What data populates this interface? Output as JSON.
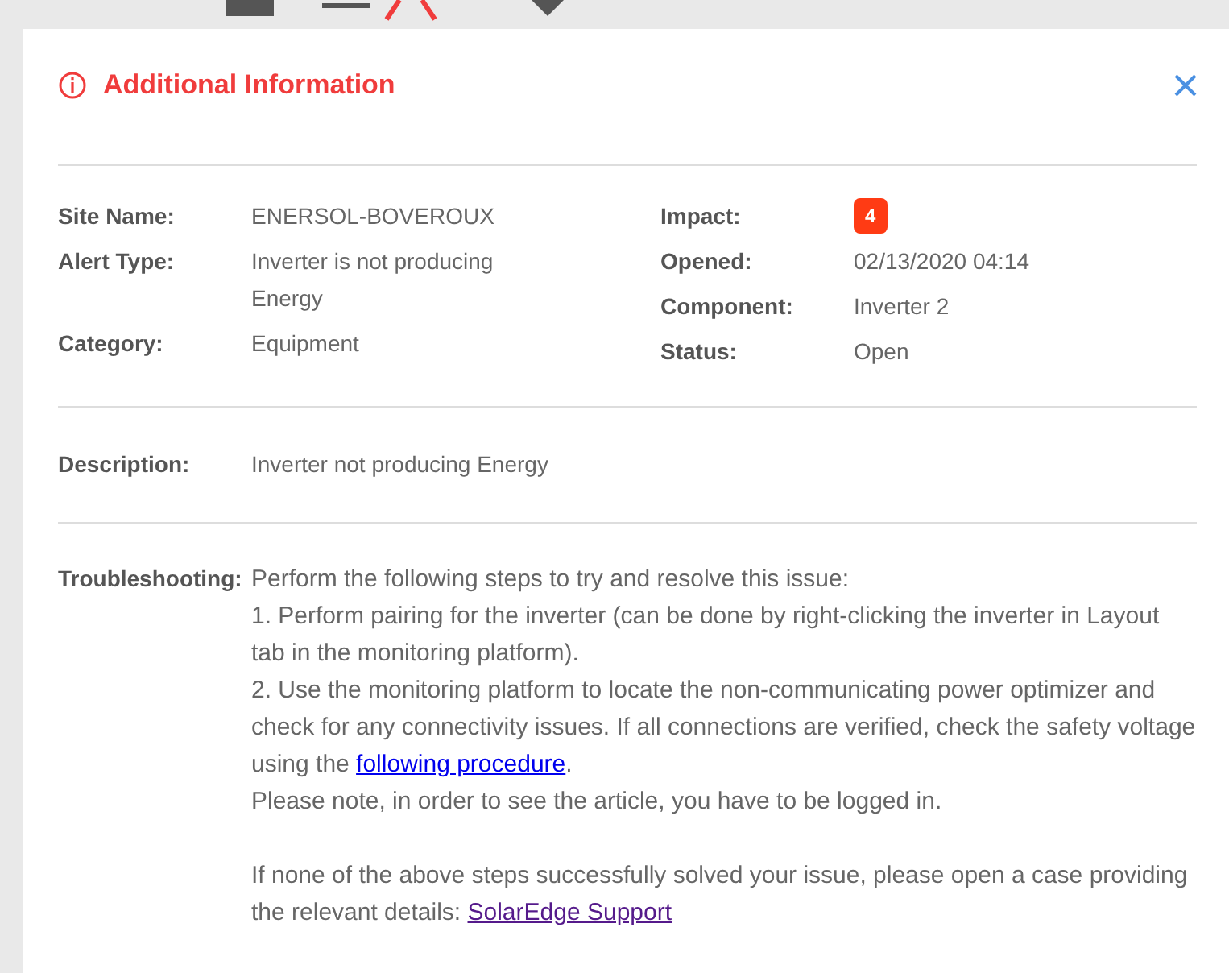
{
  "dialog": {
    "title": "Additional Information",
    "details_left": [
      {
        "label": "Site Name:",
        "value": "ENERSOL-BOVEROUX"
      },
      {
        "label": "Alert Type:",
        "value": "Inverter is not producing Energy"
      },
      {
        "label": "Category:",
        "value": "Equipment"
      }
    ],
    "details_right": [
      {
        "label": "Impact:",
        "value": "4",
        "kind": "badge"
      },
      {
        "label": "Opened:",
        "value": "02/13/2020 04:14",
        "kind": "text"
      },
      {
        "label": "Component:",
        "value": "Inverter 2",
        "kind": "text"
      },
      {
        "label": "Status:",
        "value": "Open",
        "kind": "text"
      }
    ],
    "description": {
      "label": "Description:",
      "value": "Inverter not producing Energy"
    },
    "troubleshooting": {
      "label": "Troubleshooting:",
      "paragraphs": [
        [
          {
            "kind": "text",
            "text": "Perform the following steps to try and resolve this issue:"
          }
        ],
        [
          {
            "kind": "text",
            "text": "1. Perform pairing for the inverter (can be done by right-clicking the inverter in Layout tab in the monitoring platform)."
          }
        ],
        [
          {
            "kind": "text",
            "text": "2. Use the monitoring platform to locate the non-communicating power optimizer and check for any connectivity issues. If all connections are verified, check the safety voltage using the "
          },
          {
            "kind": "link",
            "text": "following procedure",
            "visited": false
          },
          {
            "kind": "text",
            "text": "."
          }
        ],
        [
          {
            "kind": "text",
            "text": "Please note, in order to see the article, you have to be logged in."
          }
        ]
      ],
      "closing": [
        {
          "kind": "text",
          "text": "If none of the above steps successfully solved your issue, please open a case providing the relevant details: "
        },
        {
          "kind": "link",
          "text": "SolarEdge Support",
          "visited": true
        }
      ]
    }
  }
}
